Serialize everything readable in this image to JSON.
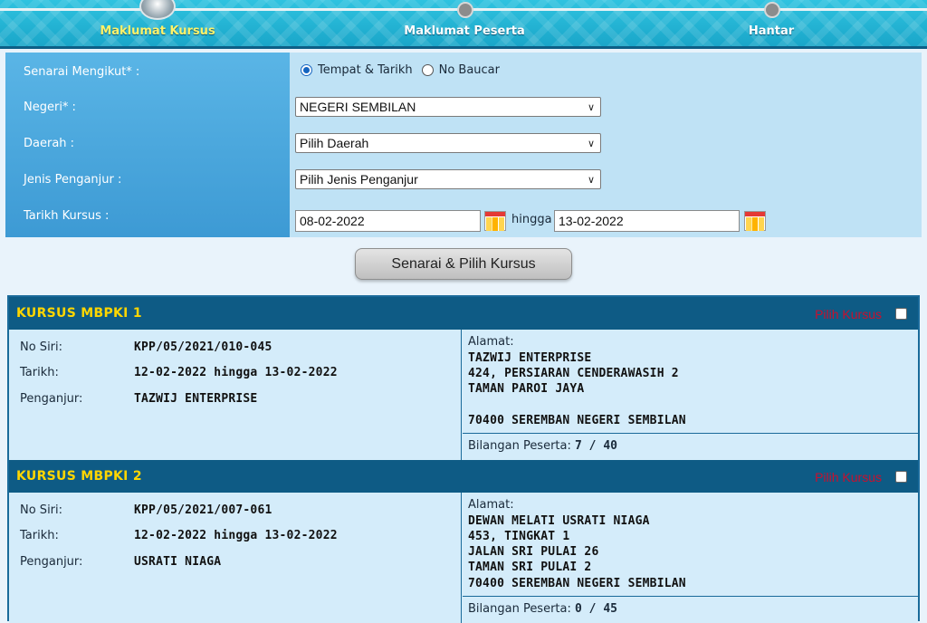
{
  "steps": [
    {
      "label": "Maklumat Kursus",
      "active": true
    },
    {
      "label": "Maklumat Peserta",
      "active": false
    },
    {
      "label": "Hantar",
      "active": false
    }
  ],
  "form": {
    "senarai_label": "Senarai Mengikut* :",
    "radio_tempat": "Tempat & Tarikh",
    "radio_baucar": "No Baucar",
    "negeri_label": "Negeri* :",
    "negeri_value": "NEGERI SEMBILAN",
    "daerah_label": "Daerah :",
    "daerah_value": "Pilih Daerah",
    "penganjur_label": "Jenis Penganjur :",
    "penganjur_value": "Pilih Jenis Penganjur",
    "tarikh_label": "Tarikh Kursus :",
    "date_from": "08-02-2022",
    "hingga": "hingga",
    "date_to": "13-02-2022"
  },
  "list_button": "Senarai & Pilih Kursus",
  "labels": {
    "pilih": "Pilih Kursus",
    "no_siri": "No Siri:",
    "tarikh": "Tarikh:",
    "penganjur": "Penganjur:",
    "alamat": "Alamat:",
    "bilangan": "Bilangan Peserta:"
  },
  "courses": [
    {
      "title": "KURSUS MBPKI 1",
      "no_siri": "KPP/05/2021/010-045",
      "tarikh": "12-02-2022 hingga 13-02-2022",
      "penganjur": "TAZWIJ ENTERPRISE",
      "alamat": [
        "TAZWIJ ENTERPRISE",
        "424, PERSIARAN CENDERAWASIH 2",
        "TAMAN PAROI JAYA",
        "",
        "70400 SEREMBAN NEGERI SEMBILAN"
      ],
      "peserta": "7 / 40"
    },
    {
      "title": "KURSUS MBPKI 2",
      "no_siri": "KPP/05/2021/007-061",
      "tarikh": "12-02-2022 hingga 13-02-2022",
      "penganjur": "USRATI NIAGA",
      "alamat": [
        "DEWAN MELATI USRATI NIAGA",
        "453, TINGKAT 1",
        "JALAN SRI PULAI 26",
        "TAMAN SRI PULAI 2",
        "70400 SEREMBAN NEGERI SEMBILAN"
      ],
      "peserta": "0 / 45"
    }
  ],
  "colors": {
    "header_bg": "#1aa6c9",
    "active_step": "#fff36a",
    "course_head": "#0e5b85",
    "course_title": "#ffd600",
    "pick_red": "#c8102e",
    "body_bg": "#d4ecfa"
  }
}
